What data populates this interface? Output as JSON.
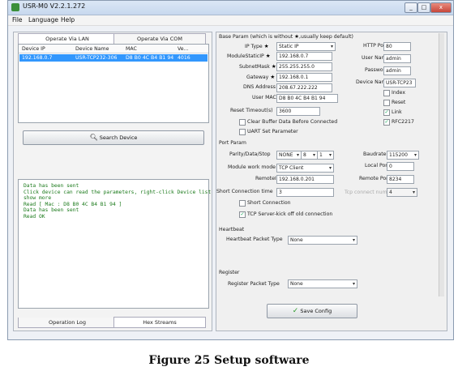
{
  "window": {
    "title": "USR-M0 V2.2.1.272",
    "min_label": "_",
    "max_label": "□",
    "close_label": "x"
  },
  "menu": {
    "file": "File",
    "language": "Language",
    "help": "Help"
  },
  "left_tabs": {
    "lan": "Operate Via LAN",
    "com": "Operate Via COM"
  },
  "device_table": {
    "headers": [
      "Device IP",
      "Device Name",
      "MAC",
      "Ve..."
    ],
    "rows": [
      [
        "192.168.0.7",
        "USR-TCP232-306",
        "D8 B0 4C B4 B1 94",
        "4016"
      ]
    ]
  },
  "search_button": "Search Device",
  "log_lines": [
    "Data has been sent",
    "Click device can read the parameters, right-click Device list",
    "show more",
    "Read [ Mac : D8 B0 4C B4 B1 94 ]",
    "Data has been sent",
    "Read OK"
  ],
  "bottom_tabs": {
    "oplog": "Operation Log",
    "hex": "Hex Streams"
  },
  "base_param": {
    "header": "Base Param (which is without ",
    "header_tail": ",usually keep default)",
    "ip_type_label": "IP Type",
    "ip_type": "Static IP",
    "static_ip_label": "ModuleStaticIP",
    "static_ip": "192.168.0.7",
    "subnet_label": "SubnetMask",
    "subnet": "255.255.255.0",
    "gateway_label": "Gateway",
    "gateway": "192.168.0.1",
    "dns_label": "DNS Address",
    "dns": "208.67.222.222",
    "mac_label": "User MAC",
    "mac": "D8 B0 4C B4 B1 94",
    "reset_label": "Reset Timeout(s)",
    "reset": "3600",
    "clear_buffer": "Clear Buffer Data Before Connected",
    "uart_set": "UART Set Parameter",
    "http_label": "HTTP Port",
    "http": "80",
    "user_label": "User Name",
    "user": "admin",
    "pass_label": "Password",
    "pass": "admin",
    "devname_label": "Device Name",
    "devname": "USR-TCP23",
    "index": "Index",
    "reset_chk": "Reset",
    "link": "Link",
    "rfc": "RFC2217"
  },
  "port_param": {
    "header": "Port Param",
    "parity_label": "Parity/Data/Stop",
    "parity": "NONE",
    "data": "8",
    "stop": "1",
    "baud_label": "Baudrate",
    "baud": "115200",
    "mode_label": "Module work mode",
    "mode": "TCP Client",
    "local_port_label": "Local Port",
    "local_port": "0",
    "remote_ip_label": "RemoteIP",
    "remote_ip": "192.168.0.201",
    "remote_port_label": "Remote Port",
    "remote_port": "8234",
    "short_conn_label": "Short Connection time",
    "short_conn": "3",
    "tcp_connect_label": "Tcp connect num",
    "tcp_connect": "4",
    "short_connection": "Short Connection",
    "kickoff": "TCP Server-kick off old connection"
  },
  "heartbeat": {
    "header": "Heartbeat",
    "label": "Heartbeat Packet Type",
    "value": "None"
  },
  "register": {
    "header": "Register",
    "label": "Register Packet Type",
    "value": "None"
  },
  "save_button": "Save Config",
  "caption": "Figure 25 Setup software"
}
